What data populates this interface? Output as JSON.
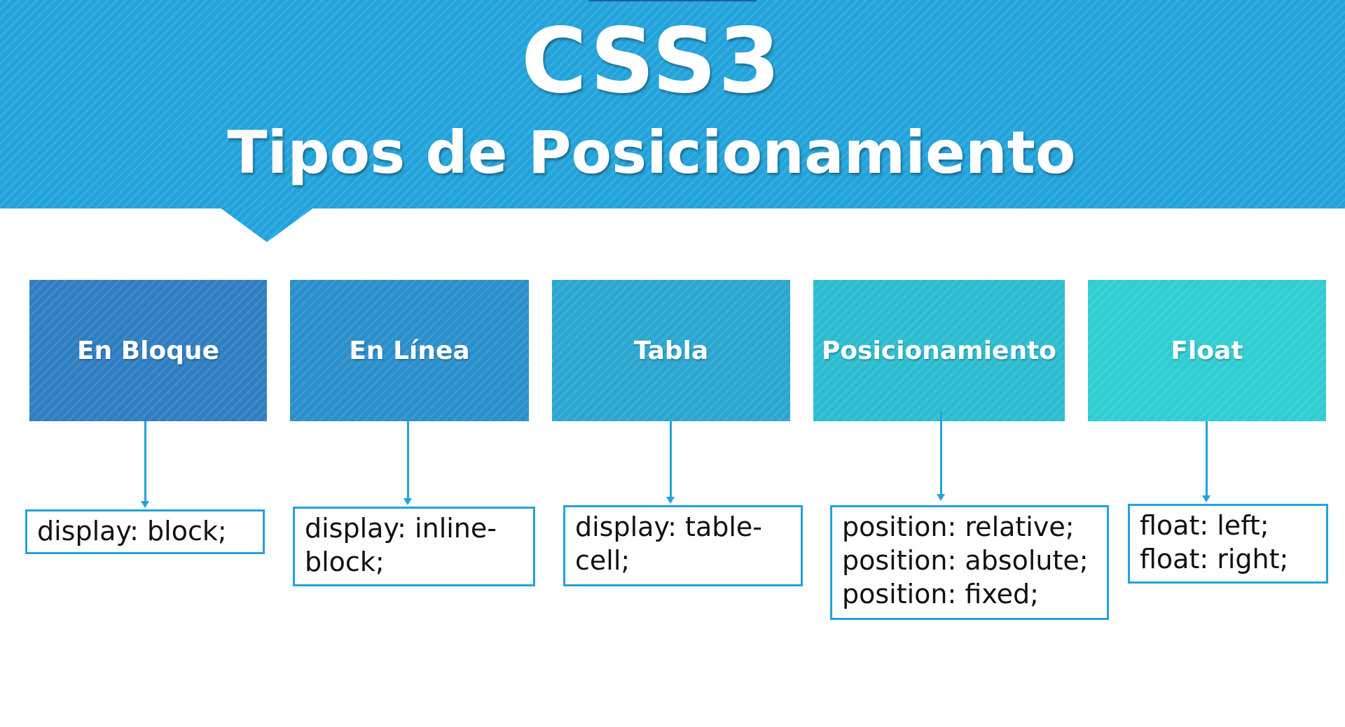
{
  "title": "CSS3",
  "subtitle": "Tipos de Posicionamiento",
  "colors": {
    "header": "#22a3db",
    "connector": "#22a3db",
    "box_border": "#22a3db",
    "categories": [
      "#2e7ec1",
      "#2a8fca",
      "#2aa6d0",
      "#2cbcd0",
      "#2ecdd2"
    ]
  },
  "categories": [
    {
      "label": "En Bloque",
      "values": [
        "display: block;"
      ]
    },
    {
      "label": "En Línea",
      "values": [
        "display: inline-",
        "block;"
      ]
    },
    {
      "label": "Tabla",
      "values": [
        "display: table-",
        "cell;"
      ]
    },
    {
      "label": "Posicionamiento",
      "values": [
        "position: relative;",
        "position: absolute;",
        "position: fixed;"
      ]
    },
    {
      "label": "Float",
      "values": [
        "float: left;",
        "float: right;"
      ]
    }
  ]
}
